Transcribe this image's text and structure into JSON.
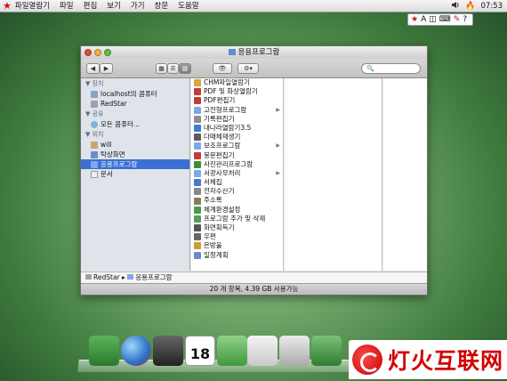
{
  "menubar": {
    "items": [
      "파일열람기",
      "파일",
      "편집",
      "보기",
      "가기",
      "창문",
      "도움말"
    ],
    "clock": "07:53"
  },
  "tray": {
    "text_input_glyph": "A"
  },
  "window": {
    "title": "응용프로그람",
    "sidebar": {
      "sections": [
        {
          "header": "장치",
          "items": [
            "localhost의 콤퓨터",
            "RedStar"
          ]
        },
        {
          "header": "공유",
          "items": [
            "모든 콤퓨터..."
          ]
        },
        {
          "header": "위치",
          "items": [
            "will",
            "탁상화면",
            "응용프로그람",
            "문서"
          ]
        }
      ],
      "selected": "응용프로그람"
    },
    "column1": [
      {
        "label": "CHM파일열람기",
        "folder": false
      },
      {
        "label": "PDF 및 화상열람기",
        "folder": false
      },
      {
        "label": "PDF편집기",
        "folder": false
      },
      {
        "label": "고전형프로그람",
        "folder": true
      },
      {
        "label": "기록편집기",
        "folder": false
      },
      {
        "label": "내나라열람기3.5",
        "folder": false
      },
      {
        "label": "다매체재생기",
        "folder": false
      },
      {
        "label": "보조프로그람",
        "folder": true
      },
      {
        "label": "봉문편집기",
        "folder": false
      },
      {
        "label": "사진관리프로그람",
        "folder": false
      },
      {
        "label": "서광사무처리",
        "folder": true
      },
      {
        "label": "서체집",
        "folder": false
      },
      {
        "label": "전자수산기",
        "folder": false
      },
      {
        "label": "주소록",
        "folder": false
      },
      {
        "label": "체계환경설정",
        "folder": false
      },
      {
        "label": "프로그람 추가 및 삭제",
        "folder": false
      },
      {
        "label": "화면획득기",
        "folder": false
      },
      {
        "label": "우편",
        "folder": false
      },
      {
        "label": "은방울",
        "folder": false
      },
      {
        "label": "일정계획",
        "folder": false
      }
    ],
    "pathbar": {
      "root": "RedStar",
      "separator": "▸",
      "current": "응용프로그람"
    },
    "status": "20 개 항목, 4.39 GB 사용가능"
  },
  "watermark": {
    "text": "灯火互联网"
  },
  "colors": {
    "selection": "#3b6fd4",
    "menubar_star": "#d21010",
    "watermark": "#d20000"
  }
}
